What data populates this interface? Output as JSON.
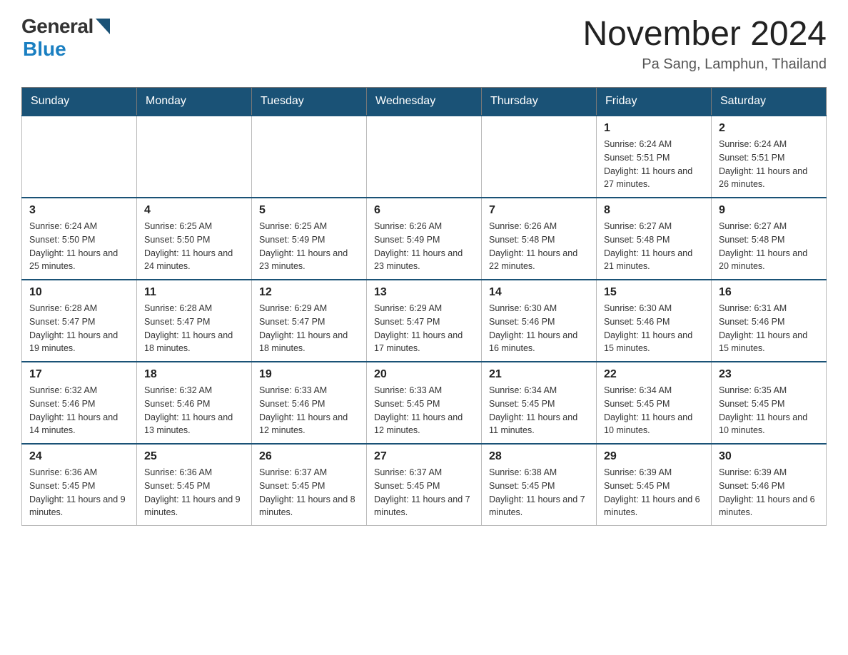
{
  "header": {
    "logo_general": "General",
    "logo_blue": "Blue",
    "month_title": "November 2024",
    "location": "Pa Sang, Lamphun, Thailand"
  },
  "weekdays": [
    "Sunday",
    "Monday",
    "Tuesday",
    "Wednesday",
    "Thursday",
    "Friday",
    "Saturday"
  ],
  "weeks": [
    [
      {
        "day": "",
        "info": ""
      },
      {
        "day": "",
        "info": ""
      },
      {
        "day": "",
        "info": ""
      },
      {
        "day": "",
        "info": ""
      },
      {
        "day": "",
        "info": ""
      },
      {
        "day": "1",
        "info": "Sunrise: 6:24 AM\nSunset: 5:51 PM\nDaylight: 11 hours and 27 minutes."
      },
      {
        "day": "2",
        "info": "Sunrise: 6:24 AM\nSunset: 5:51 PM\nDaylight: 11 hours and 26 minutes."
      }
    ],
    [
      {
        "day": "3",
        "info": "Sunrise: 6:24 AM\nSunset: 5:50 PM\nDaylight: 11 hours and 25 minutes."
      },
      {
        "day": "4",
        "info": "Sunrise: 6:25 AM\nSunset: 5:50 PM\nDaylight: 11 hours and 24 minutes."
      },
      {
        "day": "5",
        "info": "Sunrise: 6:25 AM\nSunset: 5:49 PM\nDaylight: 11 hours and 23 minutes."
      },
      {
        "day": "6",
        "info": "Sunrise: 6:26 AM\nSunset: 5:49 PM\nDaylight: 11 hours and 23 minutes."
      },
      {
        "day": "7",
        "info": "Sunrise: 6:26 AM\nSunset: 5:48 PM\nDaylight: 11 hours and 22 minutes."
      },
      {
        "day": "8",
        "info": "Sunrise: 6:27 AM\nSunset: 5:48 PM\nDaylight: 11 hours and 21 minutes."
      },
      {
        "day": "9",
        "info": "Sunrise: 6:27 AM\nSunset: 5:48 PM\nDaylight: 11 hours and 20 minutes."
      }
    ],
    [
      {
        "day": "10",
        "info": "Sunrise: 6:28 AM\nSunset: 5:47 PM\nDaylight: 11 hours and 19 minutes."
      },
      {
        "day": "11",
        "info": "Sunrise: 6:28 AM\nSunset: 5:47 PM\nDaylight: 11 hours and 18 minutes."
      },
      {
        "day": "12",
        "info": "Sunrise: 6:29 AM\nSunset: 5:47 PM\nDaylight: 11 hours and 18 minutes."
      },
      {
        "day": "13",
        "info": "Sunrise: 6:29 AM\nSunset: 5:47 PM\nDaylight: 11 hours and 17 minutes."
      },
      {
        "day": "14",
        "info": "Sunrise: 6:30 AM\nSunset: 5:46 PM\nDaylight: 11 hours and 16 minutes."
      },
      {
        "day": "15",
        "info": "Sunrise: 6:30 AM\nSunset: 5:46 PM\nDaylight: 11 hours and 15 minutes."
      },
      {
        "day": "16",
        "info": "Sunrise: 6:31 AM\nSunset: 5:46 PM\nDaylight: 11 hours and 15 minutes."
      }
    ],
    [
      {
        "day": "17",
        "info": "Sunrise: 6:32 AM\nSunset: 5:46 PM\nDaylight: 11 hours and 14 minutes."
      },
      {
        "day": "18",
        "info": "Sunrise: 6:32 AM\nSunset: 5:46 PM\nDaylight: 11 hours and 13 minutes."
      },
      {
        "day": "19",
        "info": "Sunrise: 6:33 AM\nSunset: 5:46 PM\nDaylight: 11 hours and 12 minutes."
      },
      {
        "day": "20",
        "info": "Sunrise: 6:33 AM\nSunset: 5:45 PM\nDaylight: 11 hours and 12 minutes."
      },
      {
        "day": "21",
        "info": "Sunrise: 6:34 AM\nSunset: 5:45 PM\nDaylight: 11 hours and 11 minutes."
      },
      {
        "day": "22",
        "info": "Sunrise: 6:34 AM\nSunset: 5:45 PM\nDaylight: 11 hours and 10 minutes."
      },
      {
        "day": "23",
        "info": "Sunrise: 6:35 AM\nSunset: 5:45 PM\nDaylight: 11 hours and 10 minutes."
      }
    ],
    [
      {
        "day": "24",
        "info": "Sunrise: 6:36 AM\nSunset: 5:45 PM\nDaylight: 11 hours and 9 minutes."
      },
      {
        "day": "25",
        "info": "Sunrise: 6:36 AM\nSunset: 5:45 PM\nDaylight: 11 hours and 9 minutes."
      },
      {
        "day": "26",
        "info": "Sunrise: 6:37 AM\nSunset: 5:45 PM\nDaylight: 11 hours and 8 minutes."
      },
      {
        "day": "27",
        "info": "Sunrise: 6:37 AM\nSunset: 5:45 PM\nDaylight: 11 hours and 7 minutes."
      },
      {
        "day": "28",
        "info": "Sunrise: 6:38 AM\nSunset: 5:45 PM\nDaylight: 11 hours and 7 minutes."
      },
      {
        "day": "29",
        "info": "Sunrise: 6:39 AM\nSunset: 5:45 PM\nDaylight: 11 hours and 6 minutes."
      },
      {
        "day": "30",
        "info": "Sunrise: 6:39 AM\nSunset: 5:46 PM\nDaylight: 11 hours and 6 minutes."
      }
    ]
  ]
}
